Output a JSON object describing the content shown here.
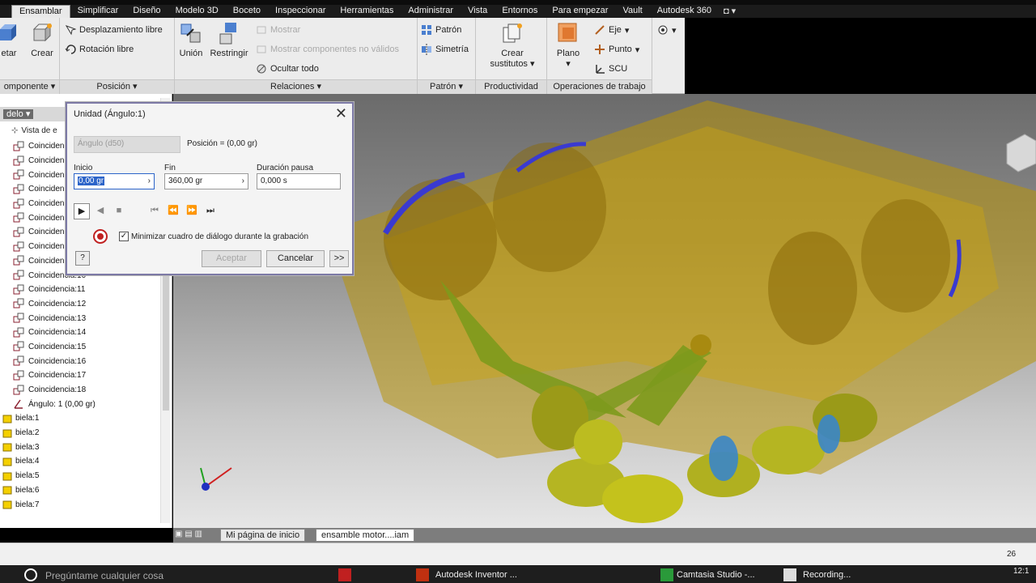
{
  "ribbon_tabs": [
    "Ensamblar",
    "Simplificar",
    "Diseño",
    "Modelo 3D",
    "Boceto",
    "Inspeccionar",
    "Herramientas",
    "Administrar",
    "Vista",
    "Entornos",
    "Para empezar",
    "Vault",
    "Autodesk 360"
  ],
  "active_tab": "Ensamblar",
  "ribbon": {
    "componente": {
      "footer": "omponente",
      "insertar": "etar",
      "crear": "Crear"
    },
    "posicion": {
      "footer": "Posición",
      "desplazamiento": "Desplazamiento libre",
      "rotacion": "Rotación libre"
    },
    "relaciones": {
      "footer": "Relaciones",
      "union": "Unión",
      "restringir": "Restringir",
      "mostrar": "Mostrar",
      "mostrar_invalidos": "Mostrar componentes no válidos",
      "ocultar_todo": "Ocultar todo"
    },
    "patron": {
      "footer": "Patrón",
      "patron": "Patrón",
      "simetria": "Simetría"
    },
    "productividad": {
      "footer": "Productividad",
      "crear_sustitutos_1": "Crear",
      "crear_sustitutos_2": "sustitutos"
    },
    "operaciones": {
      "footer": "Operaciones de trabajo",
      "plano": "Plano",
      "eje": "Eje",
      "punto": "Punto",
      "scu": "SCU"
    }
  },
  "browser": {
    "header": "delo",
    "view_label": "Vista de e",
    "items": [
      "Coincidenc",
      "Coincidenc",
      "Coinciden",
      "Coinciden",
      "Coinciden",
      "Coinciden",
      "Coinciden",
      "Coinciden",
      "Coinciden",
      "Coincidencia:10",
      "Coincidencia:11",
      "Coincidencia:12",
      "Coincidencia:13",
      "Coincidencia:14",
      "Coincidencia:15",
      "Coincidencia:16",
      "Coincidencia:17",
      "Coincidencia:18"
    ],
    "angle_item": "Ángulo: 1 (0,00 gr)",
    "parts": [
      "biela:1",
      "biela:2",
      "biela:3",
      "biela:4",
      "biela:5",
      "biela:6",
      "biela:7"
    ]
  },
  "dialog": {
    "title": "Unidad (Ángulo:1)",
    "constraint_field": "Ángulo (d50)",
    "position": "Posición = (0,00 gr)",
    "inicio_label": "Inicio",
    "inicio_value": "0,00 gr",
    "fin_label": "Fin",
    "fin_value": "360,00 gr",
    "pausa_label": "Duración pausa",
    "pausa_value": "0,000 s",
    "minimize_label": "Minimizar cuadro de diálogo durante la grabación",
    "minimize_checked": true,
    "accept_label": "Aceptar",
    "cancel_label": "Cancelar",
    "more_label": ">>"
  },
  "doc_tabs": [
    "Mi página de inicio",
    "ensamble motor....iam"
  ],
  "status": {
    "count": "26"
  },
  "taskbar": {
    "search_placeholder": "Pregúntame cualquier cosa",
    "apps": [
      "Autodesk Inventor ...",
      "Camtasia Studio -...",
      "Recording..."
    ],
    "clock": "12:1"
  },
  "colors": {
    "accent": "#2c64c9",
    "model_gold": "#b8930a",
    "rod_green": "#7d9a1c",
    "piston_blue": "#3a3ad0"
  }
}
